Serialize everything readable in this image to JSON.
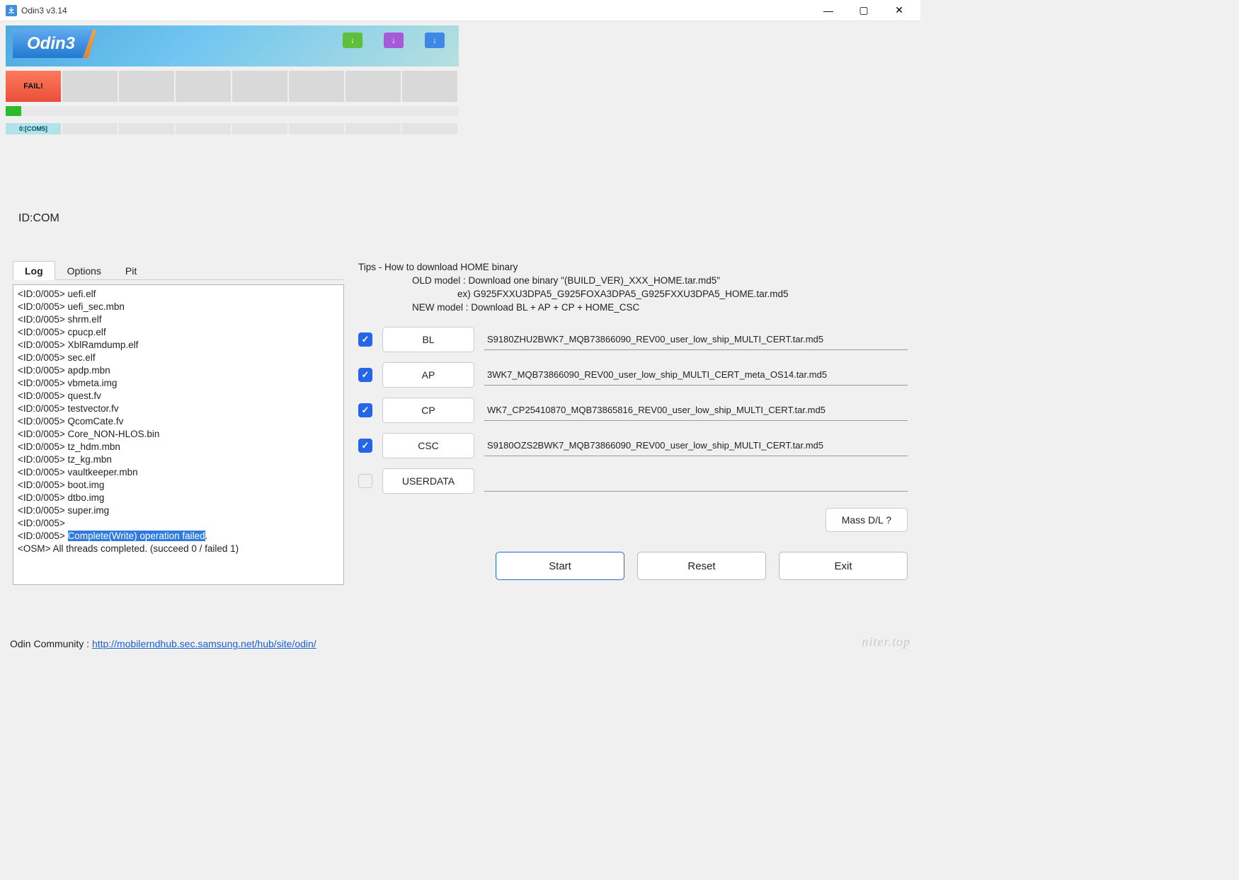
{
  "window": {
    "title": "Odin3 v3.14",
    "banner_text": "Odin3"
  },
  "slots": {
    "status0": "FAIL!",
    "com0": "0:[COM5]"
  },
  "idcom_label": "ID:COM",
  "tabs": {
    "log": "Log",
    "options": "Options",
    "pit": "Pit"
  },
  "log_lines": [
    "<ID:0/005> uefi.elf",
    "<ID:0/005> uefi_sec.mbn",
    "<ID:0/005> shrm.elf",
    "<ID:0/005> cpucp.elf",
    "<ID:0/005> XblRamdump.elf",
    "<ID:0/005> sec.elf",
    "<ID:0/005> apdp.mbn",
    "<ID:0/005> vbmeta.img",
    "<ID:0/005> quest.fv",
    "<ID:0/005> testvector.fv",
    "<ID:0/005> QcomCate.fv",
    "<ID:0/005> Core_NON-HLOS.bin",
    "<ID:0/005> tz_hdm.mbn",
    "<ID:0/005> tz_kg.mbn",
    "<ID:0/005> vaultkeeper.mbn",
    "<ID:0/005> boot.img",
    "<ID:0/005> dtbo.img",
    "<ID:0/005> super.img",
    "<ID:0/005>"
  ],
  "log_highlight_prefix": "<ID:0/005> ",
  "log_highlight": "Complete(Write) operation failed",
  "log_highlight_suffix": ".",
  "log_after": "<OSM> All threads completed. (succeed 0 / failed 1)",
  "tips": {
    "title": "Tips - How to download HOME binary",
    "line1": "OLD model  : Download one binary    \"(BUILD_VER)_XXX_HOME.tar.md5\"",
    "line2": "ex) G925FXXU3DPA5_G925FOXA3DPA5_G925FXXU3DPA5_HOME.tar.md5",
    "line3": "NEW model : Download BL + AP + CP + HOME_CSC"
  },
  "rows": {
    "bl": {
      "label": "BL",
      "checked": true,
      "path": "S9180ZHU2BWK7_MQB73866090_REV00_user_low_ship_MULTI_CERT.tar.md5"
    },
    "ap": {
      "label": "AP",
      "checked": true,
      "path": "3WK7_MQB73866090_REV00_user_low_ship_MULTI_CERT_meta_OS14.tar.md5"
    },
    "cp": {
      "label": "CP",
      "checked": true,
      "path": "WK7_CP25410870_MQB73865816_REV00_user_low_ship_MULTI_CERT.tar.md5"
    },
    "csc": {
      "label": "CSC",
      "checked": true,
      "path": "S9180OZS2BWK7_MQB73866090_REV00_user_low_ship_MULTI_CERT.tar.md5"
    },
    "ud": {
      "label": "USERDATA",
      "checked": false,
      "path": ""
    }
  },
  "buttons": {
    "massdl": "Mass D/L ?",
    "start": "Start",
    "reset": "Reset",
    "exit": "Exit"
  },
  "footer": {
    "prefix": "Odin Community : ",
    "link": "http://mobilerndhub.sec.samsung.net/hub/site/odin/"
  },
  "watermark": "niter.top"
}
